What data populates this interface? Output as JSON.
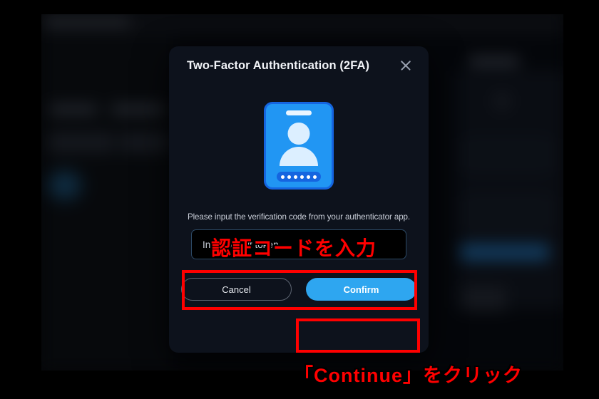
{
  "dialog": {
    "title": "Two-Factor Authentication (2FA)",
    "close_icon": "close-icon",
    "illustration": {
      "icon": "id-badge-icon",
      "dot_count": 6
    },
    "description": "Please input the verification code from your authenticator app.",
    "input": {
      "placeholder": "Input 6 digit token",
      "value": ""
    },
    "buttons": {
      "cancel_label": "Cancel",
      "confirm_label": "Confirm"
    }
  },
  "annotations": {
    "top_text": "認証コードを入力",
    "bottom_text": "「Continue」をクリック",
    "highlight_color": "#ff0000"
  },
  "colors": {
    "accent_blue": "#2ea6f0",
    "badge_blue": "#2196f3",
    "badge_border": "#1565e0",
    "dialog_bg": "#0d121c",
    "page_bg": "#000000"
  }
}
